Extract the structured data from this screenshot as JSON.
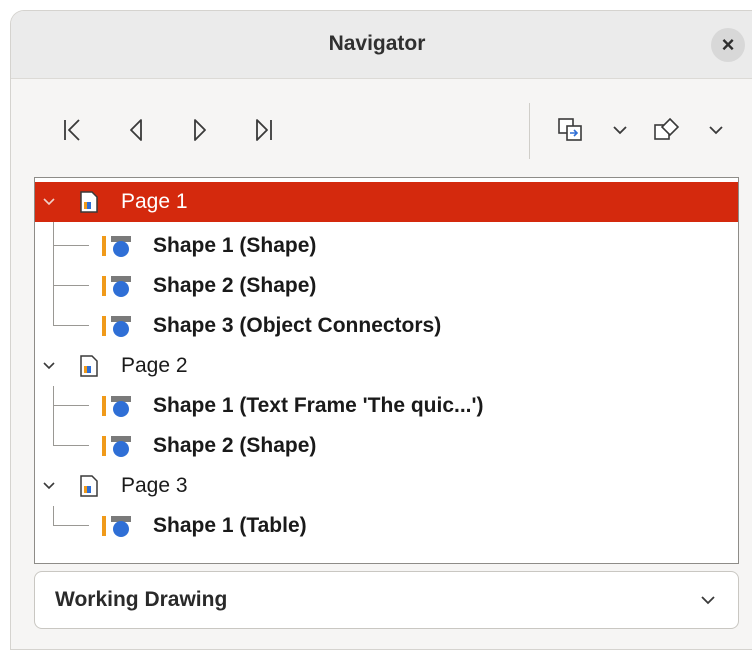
{
  "window": {
    "title": "Navigator",
    "close_label": "×"
  },
  "toolbar": {
    "buttons": [
      {
        "name": "first-page-icon"
      },
      {
        "name": "previous-page-icon"
      },
      {
        "name": "next-page-icon"
      },
      {
        "name": "last-page-icon"
      }
    ],
    "tools": [
      {
        "name": "drag-mode-icon"
      },
      {
        "name": "show-shapes-icon"
      }
    ]
  },
  "tree": {
    "pages": [
      {
        "label": "Page 1",
        "selected": true,
        "shapes": [
          "Shape 1 (Shape)",
          "Shape 2 (Shape)",
          "Shape 3 (Object Connectors)"
        ]
      },
      {
        "label": "Page 2",
        "selected": false,
        "shapes": [
          "Shape 1 (Text Frame 'The quic...')",
          "Shape 2 (Shape)"
        ]
      },
      {
        "label": "Page 3",
        "selected": false,
        "shapes": [
          "Shape 1 (Table)"
        ]
      }
    ]
  },
  "document_select": {
    "value": "Working Drawing"
  },
  "colors": {
    "selection": "#d4290d",
    "accent_blue": "#2f6fd6",
    "accent_orange": "#f09a1a"
  }
}
